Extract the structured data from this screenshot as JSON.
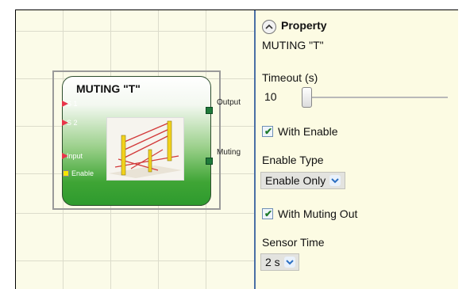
{
  "block": {
    "title": "MUTING \"T\"",
    "inputs": [
      "S 1",
      "S 2",
      "Input",
      "Enable"
    ],
    "outputs": [
      "Output",
      "Muting"
    ]
  },
  "property_panel": {
    "header": "Property",
    "subtitle": "MUTING \"T\"",
    "timeout": {
      "label": "Timeout (s)",
      "value": "10",
      "slider_level": 0.0
    },
    "with_enable": {
      "label": "With Enable",
      "checked": true
    },
    "enable_type": {
      "label": "Enable Type",
      "selected": "Enable Only"
    },
    "with_muting_out": {
      "label": "With Muting Out",
      "checked": true
    },
    "sensor_time": {
      "label": "Sensor Time",
      "selected": "2 s"
    }
  },
  "icons": [
    "collapse-chevron-up-icon",
    "checkbox-checked-icon",
    "dropdown-chevron-icon"
  ],
  "colors": {
    "panel_bg": "#fcfbe3",
    "block_green": "#3fa535",
    "input_pin": "#e8344a",
    "enable_pin": "#f5e600"
  }
}
